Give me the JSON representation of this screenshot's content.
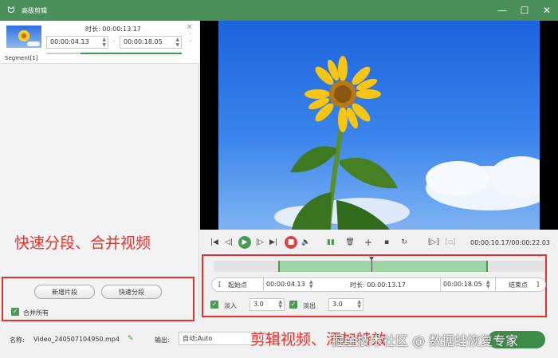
{
  "window": {
    "title": "高级剪辑",
    "min": "—",
    "max": "☐",
    "close": "✕"
  },
  "segment": {
    "duration_label": "时长: 00:00:13.17",
    "start": "00:00:04.13",
    "end": "00:00:18.05",
    "dash": "-",
    "label": "Segment[1]"
  },
  "annotations": {
    "left": "快速分段、合并视频",
    "right": "剪辑视频、添加特效"
  },
  "left_actions": {
    "new_segment": "新增片段",
    "quick_split": "快速分段",
    "merge_all": "合并所有"
  },
  "player": {
    "timecode": "00:00:10.17/00:00:22.03"
  },
  "editor": {
    "start_btn": "起始点",
    "start_time": "00:00:04.13",
    "duration": "时长: 00:00:13.17",
    "end_time": "00:00:18.05",
    "end_btn": "结束点",
    "left_bracket": "[",
    "right_bracket": "]",
    "fade_in_label": "淡入",
    "fade_in_value": "3.0",
    "fade_out_label": "淡出",
    "fade_out_value": "3.0"
  },
  "bottom": {
    "name_label": "名称:",
    "name_value": "Video_240507104950.mp4",
    "output_label": "输出:",
    "output_value": "自动;Auto"
  },
  "watermark": "掘金技术社区 @ 数据蛙恢复专家",
  "colors": {
    "accent": "#4a8f5a",
    "annotation": "#e8302a",
    "play": "#4a9a55",
    "stop": "#e04040"
  }
}
